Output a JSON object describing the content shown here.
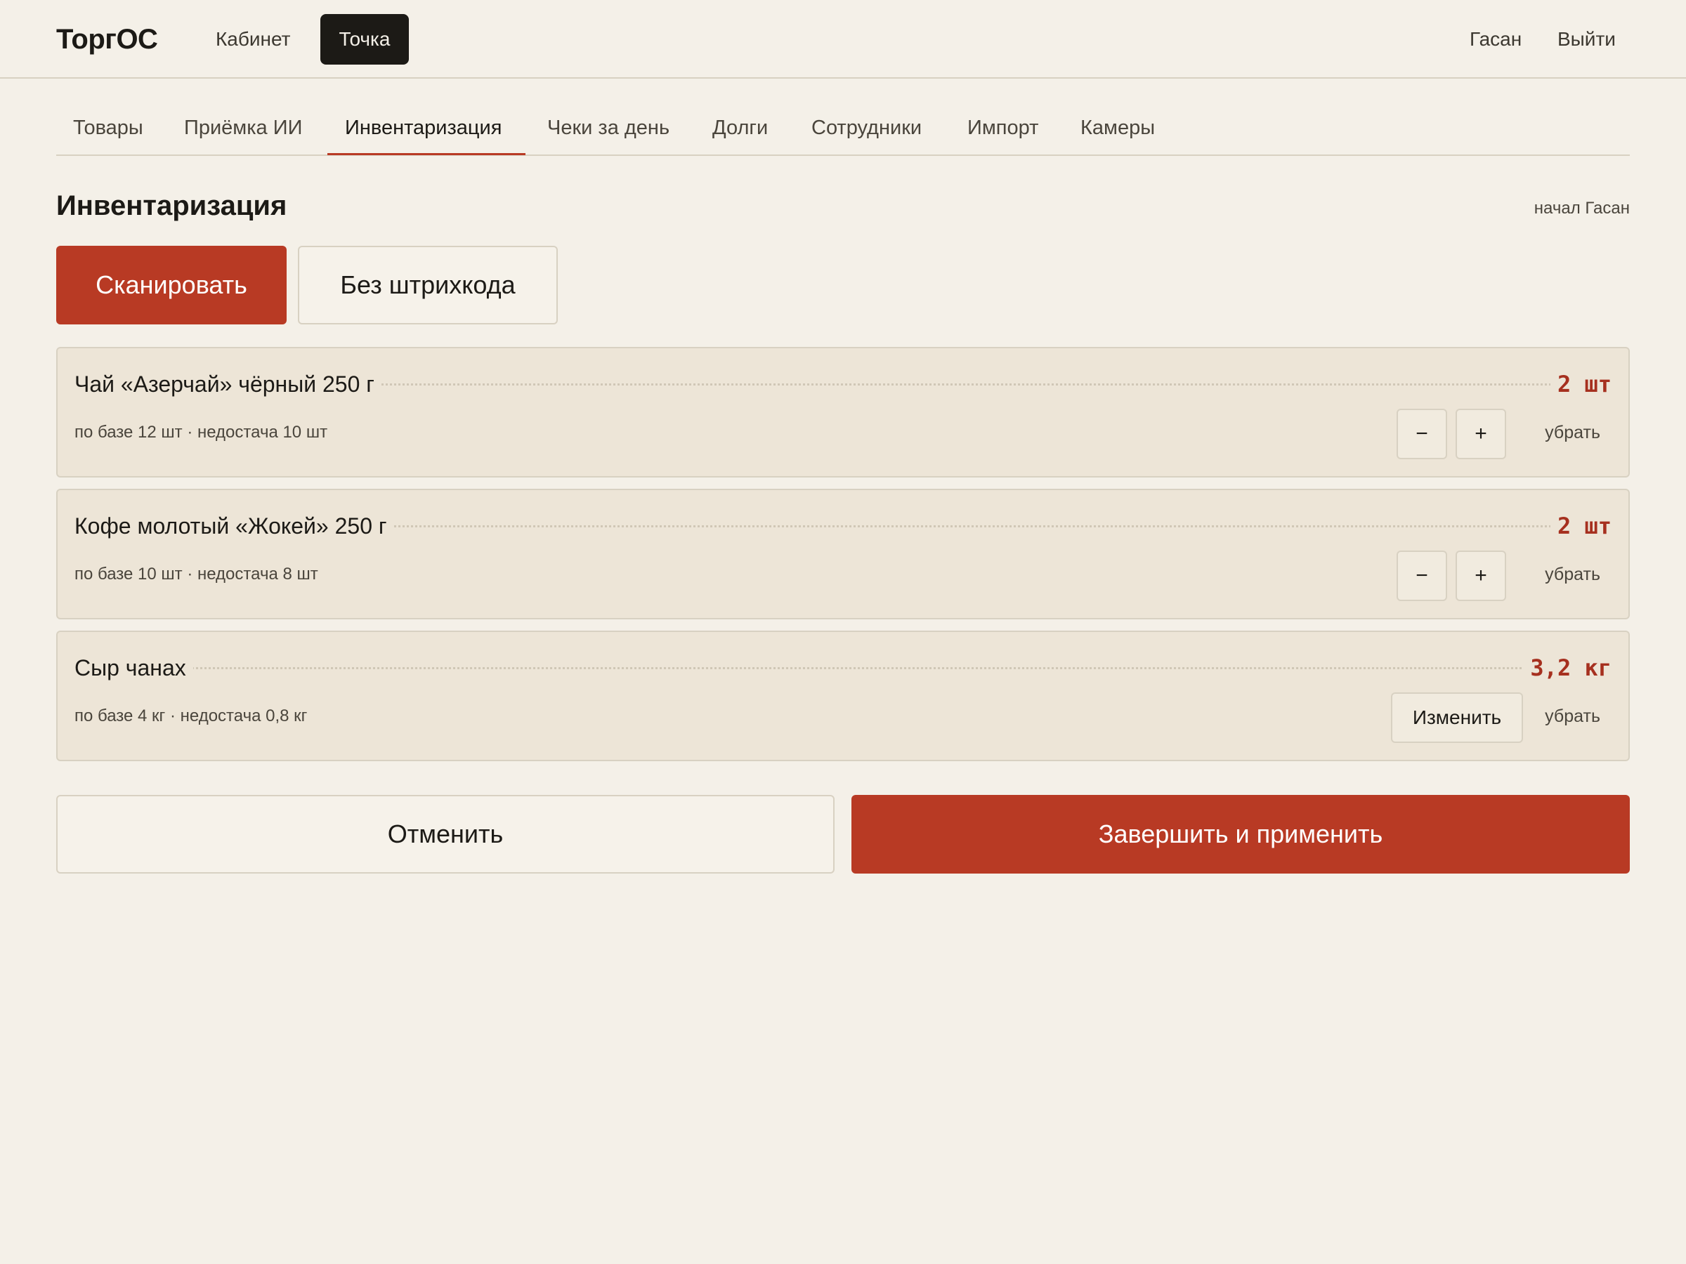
{
  "header": {
    "brand": "ТоргОС",
    "nav": [
      "Кабинет",
      "Точка"
    ],
    "active_nav": "Точка",
    "user": "Гасан",
    "logout": "Выйти"
  },
  "tabs": [
    {
      "label": "Товары",
      "active": false
    },
    {
      "label": "Приёмка ИИ",
      "active": false
    },
    {
      "label": "Инвентаризация",
      "active": true
    },
    {
      "label": "Чеки за день",
      "active": false
    },
    {
      "label": "Долги",
      "active": false
    },
    {
      "label": "Сотрудники",
      "active": false
    },
    {
      "label": "Импорт",
      "active": false
    },
    {
      "label": "Камеры",
      "active": false
    }
  ],
  "page": {
    "title": "Инвентаризация",
    "started_by": "начал Гасан",
    "scan_label": "Сканировать",
    "no_barcode_label": "Без штрихкода"
  },
  "items": [
    {
      "name": "Чай «Азерчай» чёрный 250 г",
      "qty": "2 шт",
      "sub": "по базе 12 шт · недостача 10 шт",
      "minus": "−",
      "plus": "+",
      "remove": "убрать"
    },
    {
      "name": "Кофе молотый «Жокей» 250 г",
      "qty": "2 шт",
      "sub": "по базе 10 шт · недостача 8 шт",
      "minus": "−",
      "plus": "+",
      "remove": "убрать"
    },
    {
      "name": "Сыр чанах",
      "qty": "3,2 кг",
      "sub": "по базе 4 кг · недостача 0,8 кг",
      "change": "Изменить",
      "remove": "убрать"
    }
  ],
  "footer": {
    "cancel_label": "Отменить",
    "finish_label": "Завершить и применить"
  },
  "colors": {
    "accent": "#b83a24",
    "background": "#f4f0e8",
    "card": "#ede5d7",
    "qty": "#a6301f"
  }
}
